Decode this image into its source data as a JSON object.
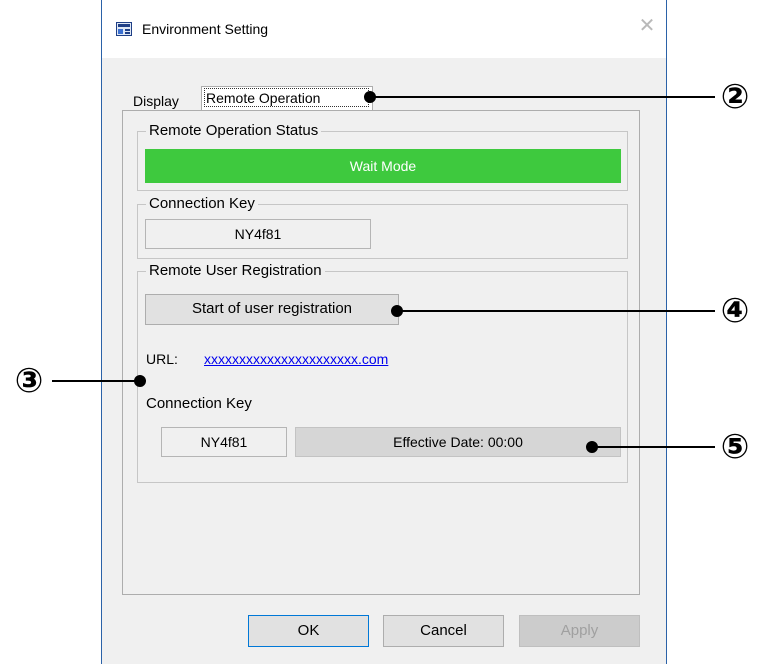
{
  "window": {
    "title": "Environment Setting",
    "close_glyph": "✕"
  },
  "tabs": [
    {
      "label": "Display",
      "selected": false
    },
    {
      "label": "Remote Operation",
      "selected": true
    }
  ],
  "status_group": {
    "label": "Remote Operation Status",
    "status_text": "Wait Mode",
    "status_color": "#3ec93e"
  },
  "connection_group": {
    "label": "Connection Key",
    "key_value": "NY4f81"
  },
  "registration_group": {
    "label": "Remote User Registration",
    "start_button_label": "Start of user registration",
    "url_label": "URL:",
    "url_value": "xxxxxxxxxxxxxxxxxxxxxx.com",
    "connection_key_label": "Connection Key",
    "connection_key_value": "NY4f81",
    "effective_date_text": "Effective Date: 00:00"
  },
  "footer": {
    "ok_label": "OK",
    "cancel_label": "Cancel",
    "apply_label": "Apply"
  },
  "callouts": {
    "two": "②",
    "three": "③",
    "four": "④",
    "five": "⑤"
  },
  "icons": {
    "app_icon": "environment-window-icon",
    "close_icon": "close-icon"
  }
}
